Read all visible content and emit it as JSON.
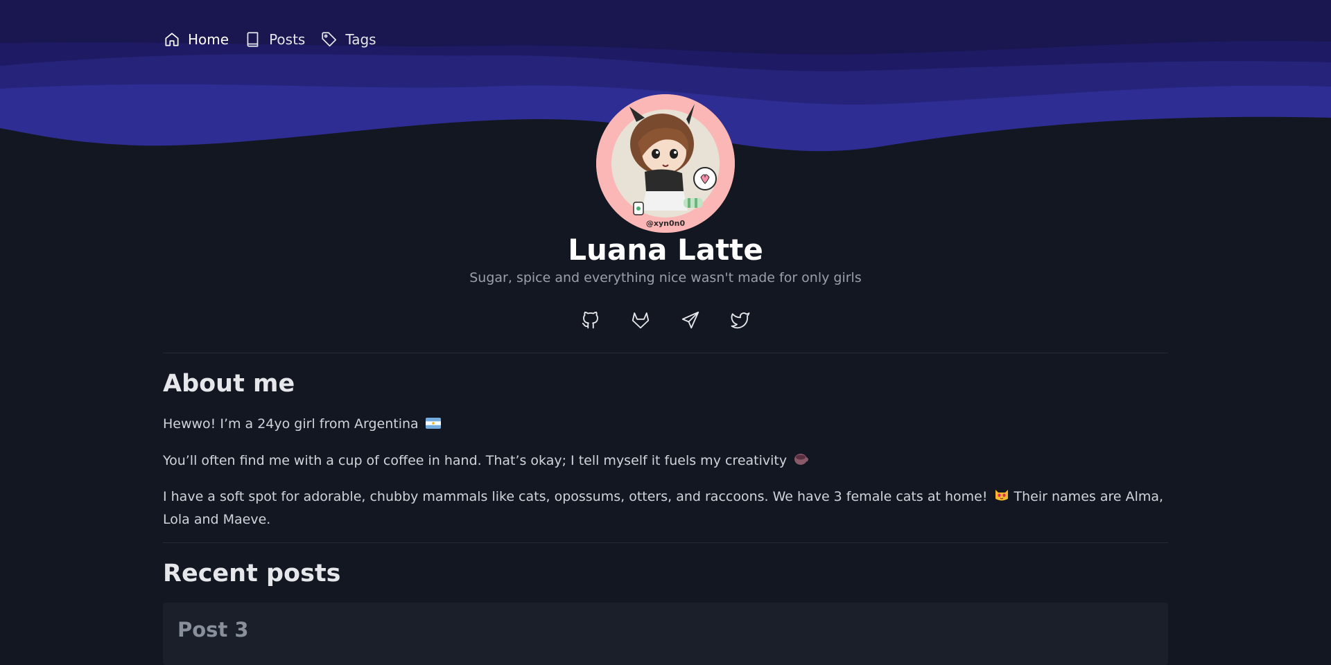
{
  "nav": {
    "items": [
      {
        "label": "Home",
        "icon": "home-icon"
      },
      {
        "label": "Posts",
        "icon": "book-icon"
      },
      {
        "label": "Tags",
        "icon": "tag-icon"
      }
    ]
  },
  "profile": {
    "name": "Luana Latte",
    "tagline": "Sugar, spice and everything nice wasn't made for only girls",
    "avatar_signature": "@xyn0n0"
  },
  "socials": [
    {
      "icon": "github-icon"
    },
    {
      "icon": "gitlab-icon"
    },
    {
      "icon": "telegram-icon"
    },
    {
      "icon": "twitter-icon"
    }
  ],
  "about": {
    "title": "About me",
    "paragraphs": [
      "Hewwo! I’m a 24yo girl from Argentina",
      "You’ll often find me with a cup of coffee in hand. That’s okay; I tell myself it fuels my creativity",
      "I have a soft spot for adorable, chubby mammals like cats, opossums, otters, and raccoons. We have 3 female cats at home!",
      "Their names are Alma, Lola and Maeve."
    ],
    "emojis": [
      "argentina-flag-icon",
      "coffee-icon",
      "cat-face-icon"
    ]
  },
  "recent_posts": {
    "title": "Recent posts",
    "items": [
      {
        "title": "Post 3"
      }
    ]
  },
  "colors": {
    "background": "#131721",
    "wave_dark": "#1a1650",
    "wave_mid": "#26237a",
    "wave_light": "#2e2d93",
    "avatar_ring": "#fbb6b6"
  }
}
